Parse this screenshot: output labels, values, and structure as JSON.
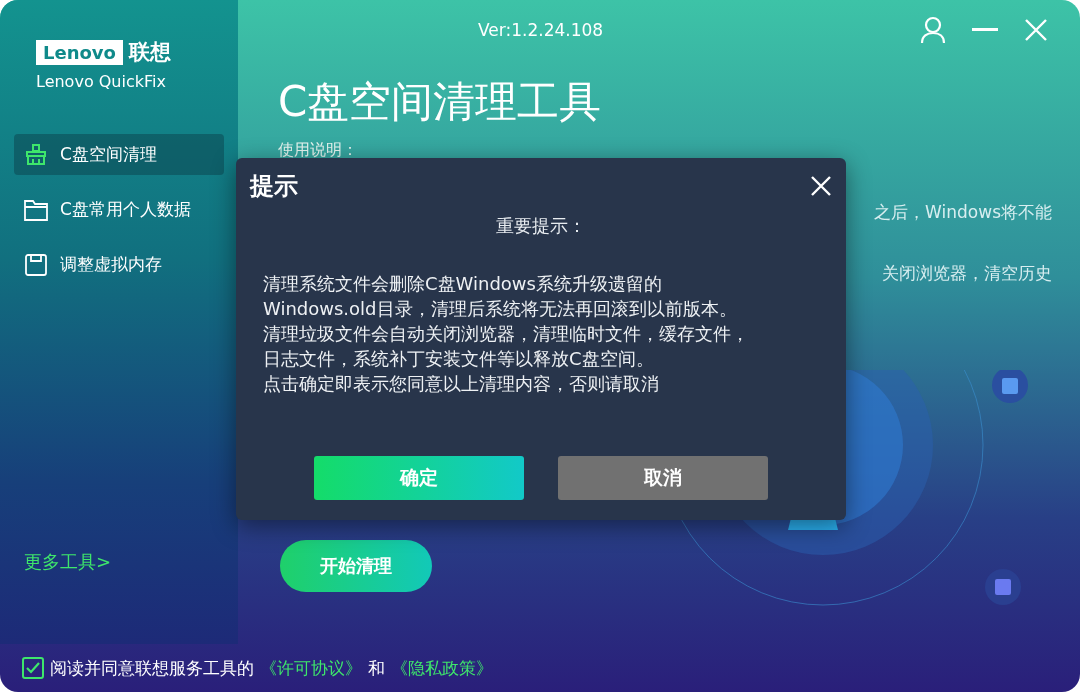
{
  "window": {
    "version": "Ver:1.2.24.108"
  },
  "logo": {
    "brand": "Lenovo",
    "brand_cn": "联想",
    "product": "Lenovo QuickFix"
  },
  "sidebar": {
    "items": [
      {
        "label": "C盘空间清理",
        "kind": "broom",
        "selected": true
      },
      {
        "label": "C盘常用个人数据",
        "kind": "folder",
        "selected": false
      },
      {
        "label": "调整虚拟内存",
        "kind": "disk",
        "selected": false
      }
    ],
    "more_link": "更多工具>"
  },
  "main": {
    "title": "C盘空间清理工具",
    "instructions_label": "使用说明：",
    "text_fragments": [
      "之后，Windows将不能",
      "关闭浏览器，清空历史"
    ],
    "start_button": "开始清理"
  },
  "dialog": {
    "title": "提示",
    "heading": "重要提示：",
    "lines": [
      "清理系统文件会删除C盘Windows系统升级遗留的",
      "Windows.old目录，清理后系统将无法再回滚到以前版本。",
      "清理垃圾文件会自动关闭浏览器，清理临时文件，缓存文件，",
      "日志文件，系统补丁安装文件等以释放C盘空间。",
      "点击确定即表示您同意以上清理内容，否则请取消"
    ],
    "confirm": "确定",
    "cancel": "取消"
  },
  "agreement": {
    "checked": true,
    "text": "阅读并同意联想服务工具的",
    "link_1": "《许可协议》",
    "joiner": "和",
    "link_2": "《隐私政策》"
  }
}
